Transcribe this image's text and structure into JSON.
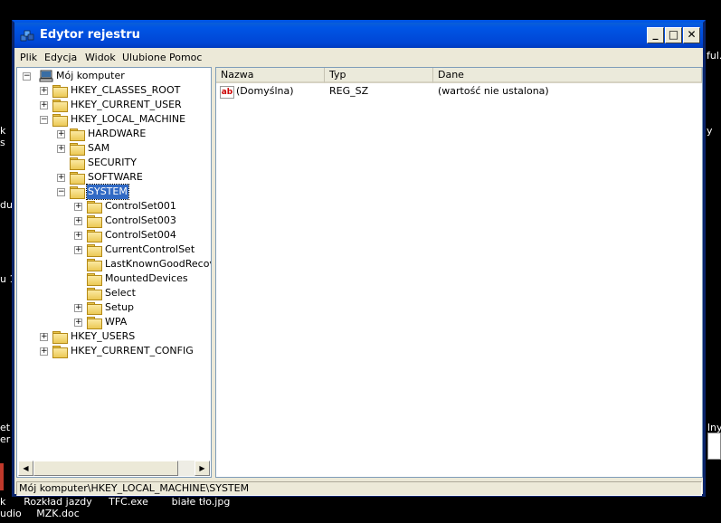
{
  "window": {
    "title": "Edytor rejestru",
    "min_glyph": "_",
    "max_glyph": "□",
    "close_glyph": "✕"
  },
  "menu": [
    "Plik",
    "Edycja",
    "Widok",
    "Ulubione",
    "Pomoc"
  ],
  "tree": {
    "root": "Mój komputer",
    "nodes": [
      {
        "label": "HKEY_CLASSES_ROOT",
        "level": 1,
        "expandable": true
      },
      {
        "label": "HKEY_CURRENT_USER",
        "level": 1,
        "expandable": true
      },
      {
        "label": "HKEY_LOCAL_MACHINE",
        "level": 1,
        "expandable": true,
        "expanded": true
      },
      {
        "label": "HARDWARE",
        "level": 2,
        "expandable": true
      },
      {
        "label": "SAM",
        "level": 2,
        "expandable": true
      },
      {
        "label": "SECURITY",
        "level": 2,
        "expandable": false
      },
      {
        "label": "SOFTWARE",
        "level": 2,
        "expandable": true
      },
      {
        "label": "SYSTEM",
        "level": 2,
        "expandable": true,
        "expanded": true,
        "selected": true
      },
      {
        "label": "ControlSet001",
        "level": 3,
        "expandable": true
      },
      {
        "label": "ControlSet003",
        "level": 3,
        "expandable": true
      },
      {
        "label": "ControlSet004",
        "level": 3,
        "expandable": true
      },
      {
        "label": "CurrentControlSet",
        "level": 3,
        "expandable": true
      },
      {
        "label": "LastKnownGoodRecove",
        "level": 3,
        "expandable": false
      },
      {
        "label": "MountedDevices",
        "level": 3,
        "expandable": false
      },
      {
        "label": "Select",
        "level": 3,
        "expandable": false
      },
      {
        "label": "Setup",
        "level": 3,
        "expandable": true
      },
      {
        "label": "WPA",
        "level": 3,
        "expandable": true
      },
      {
        "label": "HKEY_USERS",
        "level": 1,
        "expandable": true
      },
      {
        "label": "HKEY_CURRENT_CONFIG",
        "level": 1,
        "expandable": true
      }
    ]
  },
  "list": {
    "columns": [
      "Nazwa",
      "Typ",
      "Dane"
    ],
    "rows": [
      {
        "icon": "ab",
        "name": "(Domyślna)",
        "type": "REG_SZ",
        "data": "(wartość nie ustalona)"
      }
    ]
  },
  "statusbar": "Mój komputer\\HKEY_LOCAL_MACHINE\\SYSTEM",
  "desktop": {
    "fragments": [
      "ful...",
      "k",
      "s",
      "du",
      "u 1",
      "et",
      "er",
      "lny",
      "y",
      "k",
      "udio"
    ],
    "icons": [
      {
        "label": "Rozkład jazdy MZK.doc"
      },
      {
        "label": "TFC.exe"
      },
      {
        "label": "białe tło.jpg"
      }
    ]
  }
}
